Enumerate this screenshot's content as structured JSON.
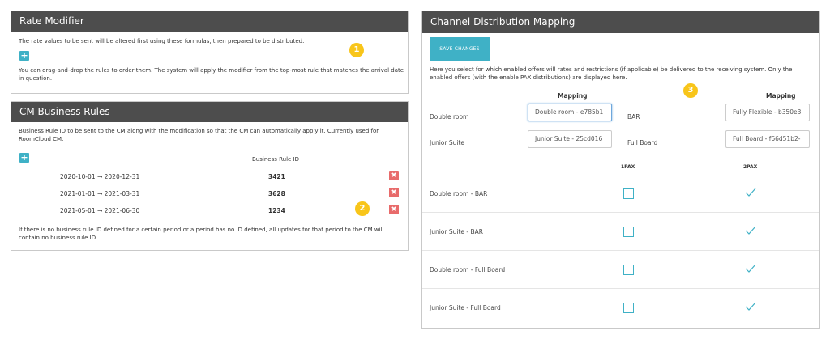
{
  "rate_modifier": {
    "title": "Rate Modifier",
    "description": "The rate values to be sent will be altered first using these formulas, then prepared to be distributed.",
    "add_label": "+",
    "help_text": "You can drag-and-drop the rules to order them. The system will apply the modifier from the top-most rule that matches the arrival date in question.",
    "badge": "1"
  },
  "cm_rules": {
    "title": "CM Business Rules",
    "description": "Business Rule ID to be sent to the CM along with the modification so that the CM can automatically apply it. Currently used for RoomCloud CM.",
    "add_label": "+",
    "column_header": "Business Rule ID",
    "rules": [
      {
        "period": "2020-10-01 → 2020-12-31",
        "id": "3421",
        "delete": "✖"
      },
      {
        "period": "2021-01-01 → 2021-03-31",
        "id": "3628",
        "delete": "✖"
      },
      {
        "period": "2021-05-01 → 2021-06-30",
        "id": "1234",
        "delete": "✖"
      }
    ],
    "footer": "If there is no business rule ID defined for a certain period or a period has no ID defined, all updates for that period to the CM will contain no business rule ID.",
    "badge": "2"
  },
  "channel": {
    "title": "Channel Distribution Mapping",
    "save_label": "SAVE CHANGES",
    "description": "Here you select for which enabled offers will rates and restrictions (if applicable) be delivered to the receiving system. Only the enabled offers (with the enable PAX distributions) are displayed here.",
    "badge": "3",
    "mapping_header_left": "Mapping",
    "mapping_header_right": "Mapping",
    "rooms": [
      {
        "label": "Double room",
        "value": "Double room - e785b1"
      },
      {
        "label": "Junior Suite",
        "value": "Junior Suite - 25cd016"
      }
    ],
    "boards": [
      {
        "label": "BAR",
        "value": "Fully Flexible - b350e3"
      },
      {
        "label": "Full Board",
        "value": "Full Board - f66d51b2-"
      }
    ],
    "pax_headers": [
      "1PAX",
      "2PAX"
    ],
    "rows": [
      {
        "name": "Double room - BAR",
        "pax1": false,
        "pax2": true
      },
      {
        "name": "Junior Suite - BAR",
        "pax1": false,
        "pax2": true
      },
      {
        "name": "Double room - Full Board",
        "pax1": false,
        "pax2": true
      },
      {
        "name": "Junior Suite - Full Board",
        "pax1": false,
        "pax2": true
      }
    ]
  },
  "colors": {
    "header_bg": "#4d4d4d",
    "accent": "#3fb1c6",
    "delete": "#e86b6b",
    "badge": "#f8c51a"
  }
}
